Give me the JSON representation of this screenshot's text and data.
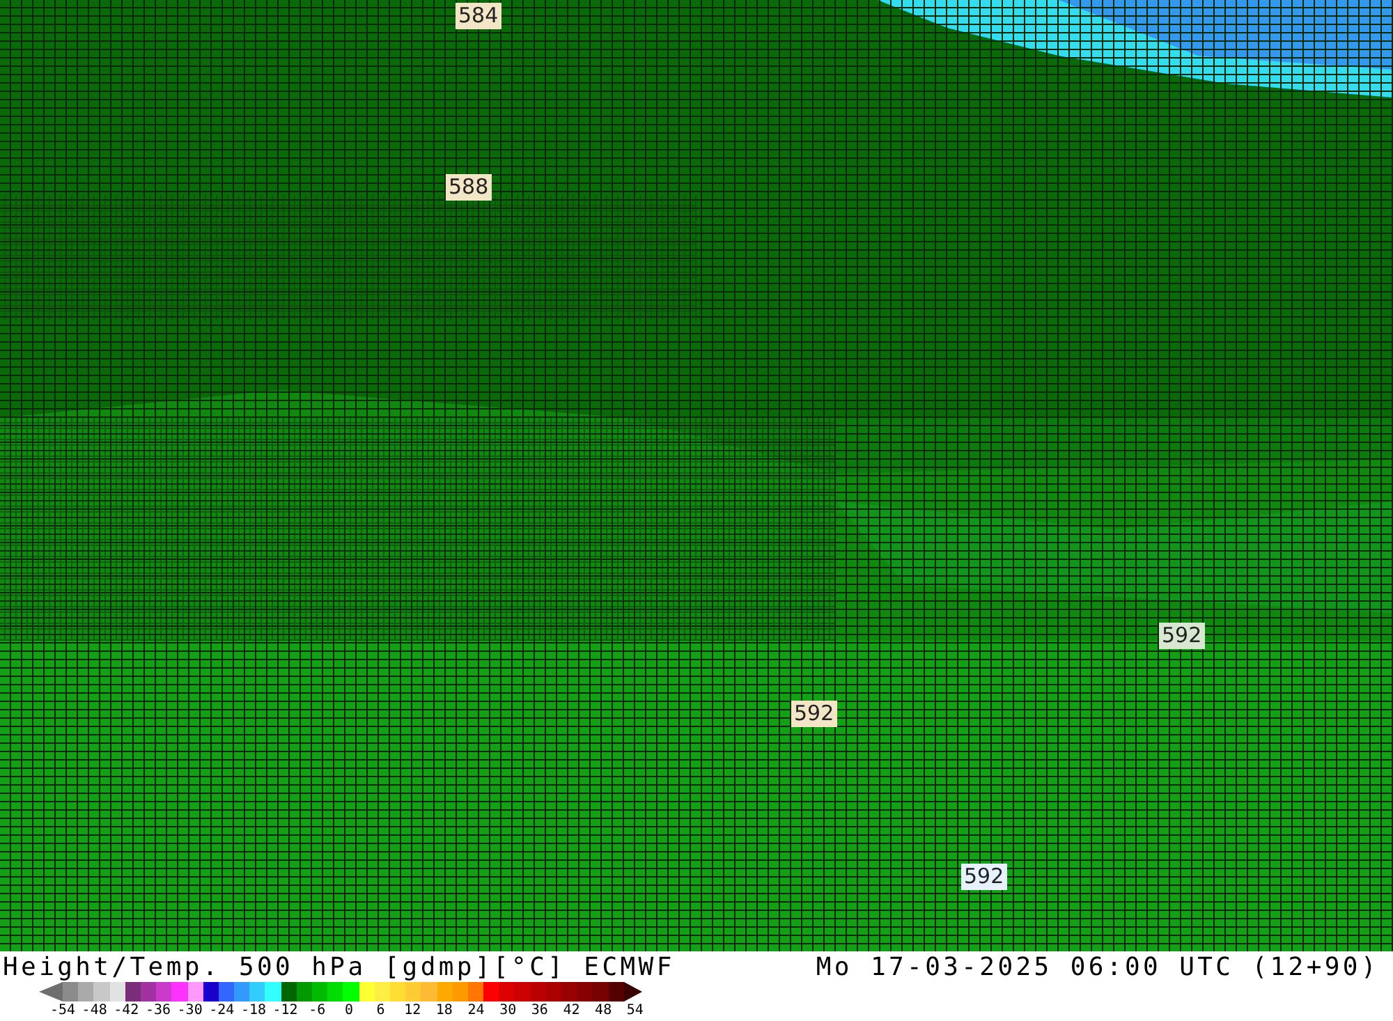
{
  "map": {
    "contour_labels": [
      "584",
      "588",
      "592",
      "592",
      "592"
    ]
  },
  "footer": {
    "title": "Height/Temp. 500 hPa [gdmp][°C] ECMWF",
    "valid_time": "Mo 17-03-2025 06:00 UTC (12+90)"
  },
  "legend": {
    "swatches": [
      {
        "color": "#8c8c8c"
      },
      {
        "color": "#aaaaaa"
      },
      {
        "color": "#c8c8c8"
      },
      {
        "color": "#e2e2e2"
      },
      {
        "color": "#7a2e7a"
      },
      {
        "color": "#a232a2"
      },
      {
        "color": "#cc3acc"
      },
      {
        "color": "#ff33ff"
      },
      {
        "color": "#ff99ff"
      },
      {
        "color": "#1a00cc"
      },
      {
        "color": "#3366ff"
      },
      {
        "color": "#3399ff"
      },
      {
        "color": "#33ccff"
      },
      {
        "color": "#33ffff"
      },
      {
        "color": "#006600"
      },
      {
        "color": "#009900"
      },
      {
        "color": "#00bb00"
      },
      {
        "color": "#00dd00"
      },
      {
        "color": "#00ff00"
      },
      {
        "color": "#ffff33"
      },
      {
        "color": "#ffee44"
      },
      {
        "color": "#ffdd33"
      },
      {
        "color": "#ffcc33"
      },
      {
        "color": "#ffbb33"
      },
      {
        "color": "#ffaa00"
      },
      {
        "color": "#ff9900"
      },
      {
        "color": "#ff7700"
      },
      {
        "color": "#ff0000"
      },
      {
        "color": "#dd0000"
      },
      {
        "color": "#cc0000"
      },
      {
        "color": "#bb0000"
      },
      {
        "color": "#aa0000"
      },
      {
        "color": "#990000"
      },
      {
        "color": "#880000"
      },
      {
        "color": "#770000"
      },
      {
        "color": "#550000"
      }
    ],
    "ticks": [
      "-54",
      "-48",
      "-42",
      "-36",
      "-30",
      "-24",
      "-18",
      "-12",
      "-6",
      "0",
      "6",
      "12",
      "18",
      "24",
      "30",
      "36",
      "42",
      "48",
      "54"
    ]
  }
}
